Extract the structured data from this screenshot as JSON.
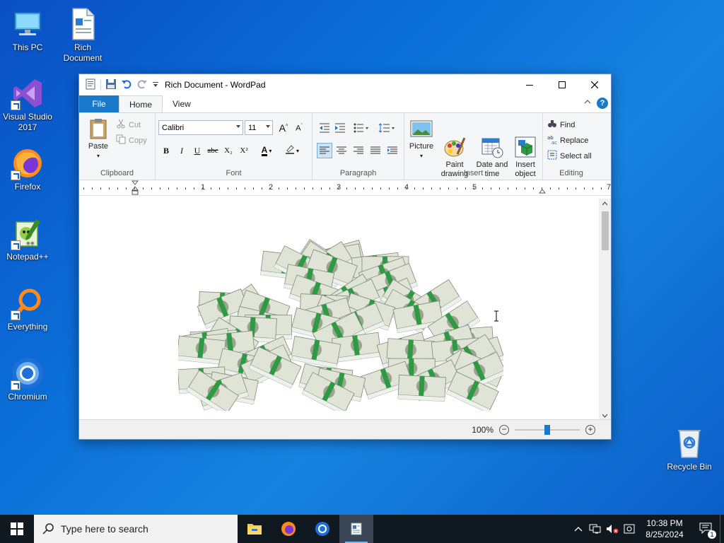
{
  "desktop": {
    "icons": [
      {
        "label": "This PC"
      },
      {
        "label": "Rich\nDocument"
      },
      {
        "label": "Visual Studio\n2017"
      },
      {
        "label": "Firefox"
      },
      {
        "label": "Notepad++"
      },
      {
        "label": "Everything"
      },
      {
        "label": "Chromium"
      },
      {
        "label": "Recycle Bin"
      }
    ]
  },
  "window": {
    "title": "Rich Document - WordPad",
    "tabs": {
      "file": "File",
      "home": "Home",
      "view": "View"
    },
    "help": "?",
    "clipboard": {
      "paste": "Paste",
      "cut": "Cut",
      "copy": "Copy",
      "label": "Clipboard"
    },
    "font": {
      "family": "Calibri",
      "size": "11",
      "label": "Font",
      "bold": "B",
      "italic": "I",
      "underline": "U",
      "strike": "abc",
      "subscript": "X₂",
      "superscript": "X²"
    },
    "paragraph": {
      "label": "Paragraph"
    },
    "insert": {
      "picture": "Picture",
      "paint": "Paint\ndrawing",
      "datetime": "Date and\ntime",
      "object": "Insert\nobject",
      "label": "Insert"
    },
    "editing": {
      "find": "Find",
      "replace": "Replace",
      "select_all": "Select all",
      "label": "Editing"
    },
    "ruler": {
      "numbers": [
        "1",
        "2",
        "3",
        "4",
        "5",
        "7"
      ]
    },
    "status": {
      "zoom": "100%",
      "zoom_level": 0.5
    }
  },
  "taskbar": {
    "search_placeholder": "Type here to search",
    "time": "10:38 PM",
    "date": "8/25/2024",
    "notification_count": "1"
  },
  "colors": {
    "accent": "#1979ca",
    "desktop": "#0b6fd8",
    "bill_green": "#2e9a44"
  }
}
